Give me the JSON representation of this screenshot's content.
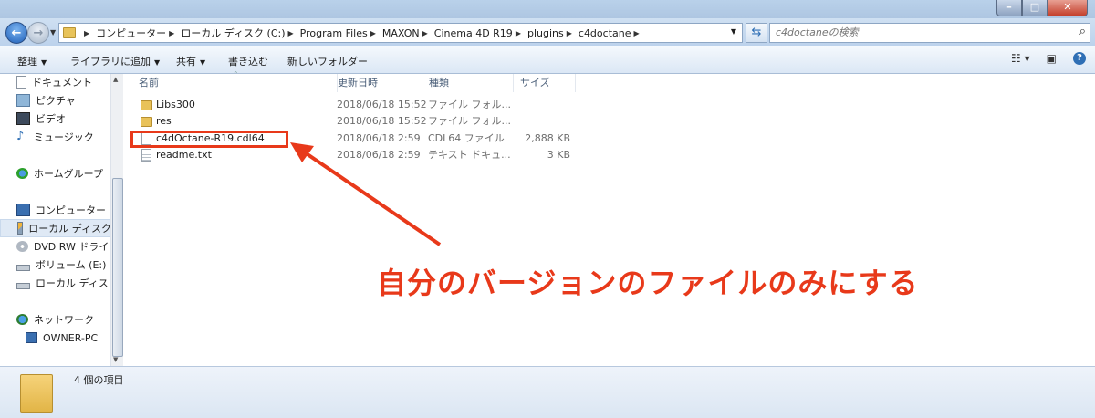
{
  "breadcrumb": [
    "コンピューター",
    "ローカル ディスク (C:)",
    "Program Files",
    "MAXON",
    "Cinema 4D R19",
    "plugins",
    "c4doctane"
  ],
  "search": {
    "placeholder": "c4doctaneの検索"
  },
  "toolbar": {
    "organize": "整理",
    "include_library": "ライブラリに追加",
    "share": "共有",
    "burn": "書き込む",
    "new_folder": "新しいフォルダー"
  },
  "nav": {
    "documents": "ドキュメント",
    "pictures": "ピクチャ",
    "videos": "ビデオ",
    "music": "ミュージック",
    "homegroup": "ホームグループ",
    "computer": "コンピューター",
    "local_disk_c": "ローカル ディスク",
    "dvd": "DVD RW ドライ",
    "volume_e": "ボリューム (E:)",
    "local_disk_2": "ローカル ディス",
    "network": "ネットワーク",
    "owner_pc": "OWNER-PC"
  },
  "columns": {
    "name": "名前",
    "modified": "更新日時",
    "type": "種類",
    "size": "サイズ"
  },
  "files": [
    {
      "name": "Libs300",
      "modified": "2018/06/18 15:52",
      "type": "ファイル フォル...",
      "size": "",
      "icon": "folder-icon"
    },
    {
      "name": "res",
      "modified": "2018/06/18 15:52",
      "type": "ファイル フォル...",
      "size": "",
      "icon": "folder-icon"
    },
    {
      "name": "c4dOctane-R19.cdl64",
      "modified": "2018/06/18 2:59",
      "type": "CDL64 ファイル",
      "size": "2,888 KB",
      "icon": "file-icon"
    },
    {
      "name": "readme.txt",
      "modified": "2018/06/18 2:59",
      "type": "テキスト ドキュ...",
      "size": "3 KB",
      "icon": "text-file-icon"
    }
  ],
  "status": {
    "count": "4 個の項目"
  },
  "annotation": {
    "text": "自分のバージョンのファイルのみにする",
    "color": "#e8391a"
  }
}
